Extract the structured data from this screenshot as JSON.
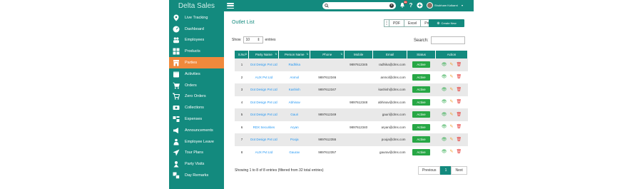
{
  "app": {
    "brand": "Delta Sales"
  },
  "sidebar": {
    "items": [
      {
        "label": "Live Tracking",
        "icon": "map-marker-icon",
        "active": false
      },
      {
        "label": "Dashboard",
        "icon": "dashboard-icon",
        "active": false
      },
      {
        "label": "Employees",
        "icon": "employees-icon",
        "active": false
      },
      {
        "label": "Products",
        "icon": "grid-icon",
        "active": false
      },
      {
        "label": "Parties",
        "icon": "store-icon",
        "active": true
      },
      {
        "label": "Activities",
        "icon": "activities-icon",
        "active": false
      },
      {
        "label": "Orders",
        "icon": "cart-icon",
        "active": false
      },
      {
        "label": "Zero Orders",
        "icon": "cart-empty-icon",
        "active": false
      },
      {
        "label": "Collections",
        "icon": "money-icon",
        "active": false
      },
      {
        "label": "Expenses",
        "icon": "expense-icon",
        "active": false
      },
      {
        "label": "Announcements",
        "icon": "megaphone-icon",
        "active": false
      },
      {
        "label": "Employee Leave",
        "icon": "leave-icon",
        "active": false
      },
      {
        "label": "Tour Plans",
        "icon": "plane-icon",
        "active": false
      },
      {
        "label": "Party Visits",
        "icon": "visit-icon",
        "active": false
      },
      {
        "label": "Day Remarks",
        "icon": "remarks-icon",
        "active": false
      }
    ]
  },
  "topbar": {
    "search_placeholder": "",
    "notification_count": "99",
    "user_name": "Shubham Kulkarni",
    "colors": {
      "bar": "#138a7e",
      "active_item": "#f0893c"
    }
  },
  "panel": {
    "title": "Outlet List",
    "export_buttons": [
      "PDF",
      "Excel",
      "Print"
    ],
    "create_button": "Create New",
    "show_label": "Show",
    "show_value": "10",
    "entries_label": "entries",
    "search_label": "Search:"
  },
  "table": {
    "columns": [
      "S.No",
      "Party Name",
      "Person Name",
      "Phone",
      "Mobile",
      "Email",
      "Status",
      "Action"
    ],
    "rows": [
      {
        "sno": "1",
        "party": "Dot Design Pvt Ltd",
        "person": "Radhika",
        "phone": "",
        "mobile": "9897612345",
        "email": "radhika@dms.com",
        "status": "Active"
      },
      {
        "sno": "2",
        "party": "AUX Pvt Ltd",
        "person": "Anmol",
        "phone": "9897612346",
        "mobile": "",
        "email": "anmol@dms.com",
        "status": "Active"
      },
      {
        "sno": "3",
        "party": "Dot Design Pvt Ltd",
        "person": "Kashish",
        "phone": "9897612347",
        "mobile": "",
        "email": "kashish@dms.com",
        "status": "Active"
      },
      {
        "sno": "4",
        "party": "Dot Design Pvt Ltd",
        "person": "Abhinav",
        "phone": "",
        "mobile": "9897612348",
        "email": "abhinav@dms.com",
        "status": "Active"
      },
      {
        "sno": "5",
        "party": "Dot Design Pvt Ltd",
        "person": "Gauri",
        "phone": "9897612349",
        "mobile": "",
        "email": "gauri@dms.com",
        "status": "Active"
      },
      {
        "sno": "6",
        "party": "RDX Securities",
        "person": "Aryan",
        "phone": "",
        "mobile": "9897612340",
        "email": "aryan@dms.com",
        "status": "Active"
      },
      {
        "sno": "7",
        "party": "Dot Design Pvt Ltd",
        "person": "Pooja",
        "phone": "9897612355",
        "mobile": "",
        "email": "pooja@dms.com",
        "status": "Active"
      },
      {
        "sno": "8",
        "party": "AUX Pvt Ltd",
        "person": "Gaurav",
        "phone": "9897612357",
        "mobile": "",
        "email": "gaurav@dms.com",
        "status": "Active"
      }
    ]
  },
  "footer": {
    "info": "Showing 1 to 8 of 8 entries (filtered from 32 total entries)",
    "prev": "Previous",
    "page": "1",
    "next": "Next"
  }
}
